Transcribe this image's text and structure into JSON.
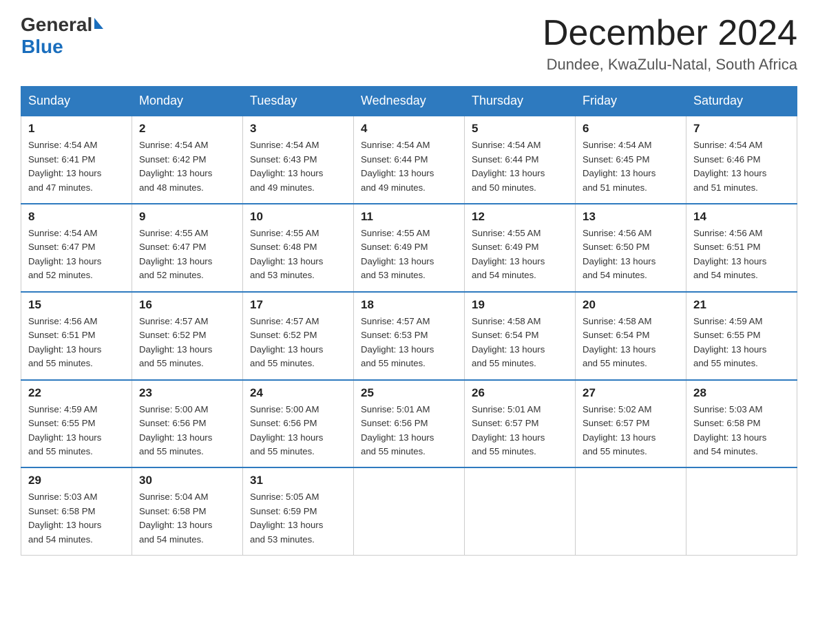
{
  "header": {
    "logo_general": "General",
    "logo_blue": "Blue",
    "month_title": "December 2024",
    "location": "Dundee, KwaZulu-Natal, South Africa"
  },
  "calendar": {
    "days_of_week": [
      "Sunday",
      "Monday",
      "Tuesday",
      "Wednesday",
      "Thursday",
      "Friday",
      "Saturday"
    ],
    "weeks": [
      [
        {
          "day": "1",
          "info": "Sunrise: 4:54 AM\nSunset: 6:41 PM\nDaylight: 13 hours\nand 47 minutes."
        },
        {
          "day": "2",
          "info": "Sunrise: 4:54 AM\nSunset: 6:42 PM\nDaylight: 13 hours\nand 48 minutes."
        },
        {
          "day": "3",
          "info": "Sunrise: 4:54 AM\nSunset: 6:43 PM\nDaylight: 13 hours\nand 49 minutes."
        },
        {
          "day": "4",
          "info": "Sunrise: 4:54 AM\nSunset: 6:44 PM\nDaylight: 13 hours\nand 49 minutes."
        },
        {
          "day": "5",
          "info": "Sunrise: 4:54 AM\nSunset: 6:44 PM\nDaylight: 13 hours\nand 50 minutes."
        },
        {
          "day": "6",
          "info": "Sunrise: 4:54 AM\nSunset: 6:45 PM\nDaylight: 13 hours\nand 51 minutes."
        },
        {
          "day": "7",
          "info": "Sunrise: 4:54 AM\nSunset: 6:46 PM\nDaylight: 13 hours\nand 51 minutes."
        }
      ],
      [
        {
          "day": "8",
          "info": "Sunrise: 4:54 AM\nSunset: 6:47 PM\nDaylight: 13 hours\nand 52 minutes."
        },
        {
          "day": "9",
          "info": "Sunrise: 4:55 AM\nSunset: 6:47 PM\nDaylight: 13 hours\nand 52 minutes."
        },
        {
          "day": "10",
          "info": "Sunrise: 4:55 AM\nSunset: 6:48 PM\nDaylight: 13 hours\nand 53 minutes."
        },
        {
          "day": "11",
          "info": "Sunrise: 4:55 AM\nSunset: 6:49 PM\nDaylight: 13 hours\nand 53 minutes."
        },
        {
          "day": "12",
          "info": "Sunrise: 4:55 AM\nSunset: 6:49 PM\nDaylight: 13 hours\nand 54 minutes."
        },
        {
          "day": "13",
          "info": "Sunrise: 4:56 AM\nSunset: 6:50 PM\nDaylight: 13 hours\nand 54 minutes."
        },
        {
          "day": "14",
          "info": "Sunrise: 4:56 AM\nSunset: 6:51 PM\nDaylight: 13 hours\nand 54 minutes."
        }
      ],
      [
        {
          "day": "15",
          "info": "Sunrise: 4:56 AM\nSunset: 6:51 PM\nDaylight: 13 hours\nand 55 minutes."
        },
        {
          "day": "16",
          "info": "Sunrise: 4:57 AM\nSunset: 6:52 PM\nDaylight: 13 hours\nand 55 minutes."
        },
        {
          "day": "17",
          "info": "Sunrise: 4:57 AM\nSunset: 6:52 PM\nDaylight: 13 hours\nand 55 minutes."
        },
        {
          "day": "18",
          "info": "Sunrise: 4:57 AM\nSunset: 6:53 PM\nDaylight: 13 hours\nand 55 minutes."
        },
        {
          "day": "19",
          "info": "Sunrise: 4:58 AM\nSunset: 6:54 PM\nDaylight: 13 hours\nand 55 minutes."
        },
        {
          "day": "20",
          "info": "Sunrise: 4:58 AM\nSunset: 6:54 PM\nDaylight: 13 hours\nand 55 minutes."
        },
        {
          "day": "21",
          "info": "Sunrise: 4:59 AM\nSunset: 6:55 PM\nDaylight: 13 hours\nand 55 minutes."
        }
      ],
      [
        {
          "day": "22",
          "info": "Sunrise: 4:59 AM\nSunset: 6:55 PM\nDaylight: 13 hours\nand 55 minutes."
        },
        {
          "day": "23",
          "info": "Sunrise: 5:00 AM\nSunset: 6:56 PM\nDaylight: 13 hours\nand 55 minutes."
        },
        {
          "day": "24",
          "info": "Sunrise: 5:00 AM\nSunset: 6:56 PM\nDaylight: 13 hours\nand 55 minutes."
        },
        {
          "day": "25",
          "info": "Sunrise: 5:01 AM\nSunset: 6:56 PM\nDaylight: 13 hours\nand 55 minutes."
        },
        {
          "day": "26",
          "info": "Sunrise: 5:01 AM\nSunset: 6:57 PM\nDaylight: 13 hours\nand 55 minutes."
        },
        {
          "day": "27",
          "info": "Sunrise: 5:02 AM\nSunset: 6:57 PM\nDaylight: 13 hours\nand 55 minutes."
        },
        {
          "day": "28",
          "info": "Sunrise: 5:03 AM\nSunset: 6:58 PM\nDaylight: 13 hours\nand 54 minutes."
        }
      ],
      [
        {
          "day": "29",
          "info": "Sunrise: 5:03 AM\nSunset: 6:58 PM\nDaylight: 13 hours\nand 54 minutes."
        },
        {
          "day": "30",
          "info": "Sunrise: 5:04 AM\nSunset: 6:58 PM\nDaylight: 13 hours\nand 54 minutes."
        },
        {
          "day": "31",
          "info": "Sunrise: 5:05 AM\nSunset: 6:59 PM\nDaylight: 13 hours\nand 53 minutes."
        },
        {
          "day": "",
          "info": ""
        },
        {
          "day": "",
          "info": ""
        },
        {
          "day": "",
          "info": ""
        },
        {
          "day": "",
          "info": ""
        }
      ]
    ]
  }
}
